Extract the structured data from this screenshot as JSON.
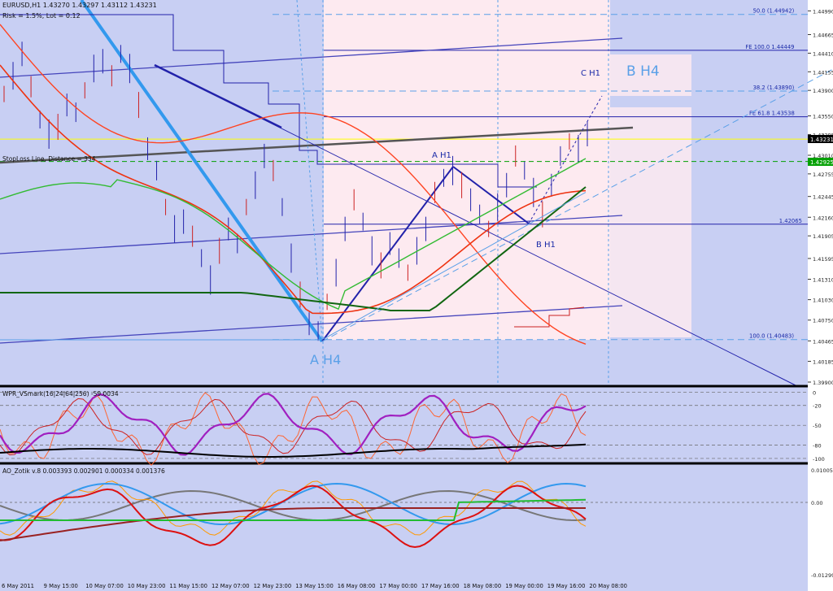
{
  "window": {
    "header": "EURUSD,H1  1.43270 1.43297 1.43112 1.43231",
    "risk_text": "Risk = 1.5%, Lot = 0.12",
    "stoploss_label": "StopLoss Line, Distance = 334"
  },
  "chart_data": [
    {
      "type": "line",
      "panel": "price",
      "symbol": "EURUSD",
      "timeframe": "H1",
      "ohlc": {
        "open": 1.4327,
        "high": 1.43297,
        "low": 1.43112,
        "close": 1.43231
      },
      "ylim": [
        1.399,
        1.4505
      ],
      "y_ticks": [
        "1.44990",
        "1.44665",
        "1.44410",
        "1.44155",
        "1.43900",
        "1.43550",
        "1.43295",
        "1.43010",
        "1.42755",
        "1.42445",
        "1.42160",
        "1.41905",
        "1.41595",
        "1.41310",
        "1.41030",
        "1.40750",
        "1.40465",
        "1.40185",
        "1.39900"
      ],
      "current_price": "1.43231",
      "stoploss_price": "1.42925",
      "series": [
        {
          "name": "price",
          "values": [
            1.4385,
            1.441,
            1.444,
            1.4395,
            1.435,
            1.433,
            1.434,
            1.437,
            1.436,
            1.439,
            1.442,
            1.443,
            1.441,
            1.444,
            1.442,
            1.437,
            1.431,
            1.428,
            1.423,
            1.42,
            1.421,
            1.419,
            1.416,
            1.413,
            1.417,
            1.42,
            1.418,
            1.423,
            1.426,
            1.43,
            1.428,
            1.423,
            1.416,
            1.411,
            1.407,
            1.406,
            1.41,
            1.414,
            1.42,
            1.424,
            1.421,
            1.417,
            1.415,
            1.418,
            1.416,
            1.414,
            1.417,
            1.42,
            1.425,
            1.427,
            1.428,
            1.426,
            1.424,
            1.422,
            1.42,
            1.423,
            1.426,
            1.43,
            1.428,
            1.425,
            1.422,
            1.426,
            1.43,
            1.432,
            1.431,
            1.433
          ]
        }
      ],
      "levels": [
        {
          "label": "50.0 (1.44942)",
          "value": 1.44942
        },
        {
          "label": "FE 100.0 1.44449",
          "value": 1.44449
        },
        {
          "label": "38.2 (1.43890)",
          "value": 1.4389
        },
        {
          "label": "FE 61.8 1.43538",
          "value": 1.43538
        },
        {
          "label": "1.42065",
          "value": 1.42065
        },
        {
          "label": "100.0 (1.40483)",
          "value": 1.40483
        }
      ],
      "annotations": [
        "A H4",
        "B H4",
        "A H1",
        "B H1",
        "C H1"
      ],
      "x_ticks": [
        "6 May 2011",
        "9 May 15:00",
        "10 May 07:00",
        "10 May 23:00",
        "11 May 15:00",
        "12 May 07:00",
        "12 May 23:00",
        "13 May 15:00",
        "16 May 08:00",
        "17 May 00:00",
        "17 May 16:00",
        "18 May 08:00",
        "19 May 00:00",
        "19 May 16:00",
        "20 May 08:00"
      ]
    },
    {
      "type": "line",
      "panel": "indicator",
      "title": "WPR_VSmark(16|24|64|256) -59.0034",
      "ylim": [
        -105,
        3
      ],
      "y_ticks": [
        "0",
        "-20",
        "-50",
        "-80",
        "-100"
      ]
    },
    {
      "type": "line",
      "panel": "indicator",
      "title": "AO_Zotik v.8 0.003393 0.002901 0.000334 0.001376",
      "y_ticks": [
        "0.01005",
        "0.00",
        "-0.01299"
      ]
    }
  ],
  "colors": {
    "background": "#c8cff3",
    "pink_zone": "#fdeaf0",
    "line_blue": "#2222aa",
    "thick_blue": "#3399ee",
    "fib_blue": "#5aa0e8",
    "text_blue": "#1a2aa8",
    "current_price": "#ffff00",
    "stoploss": "#00a000",
    "wpr_purple": "#a020c0",
    "ao_blue": "#3399ee",
    "ao_red": "#dd1111",
    "ao_darkred": "#992222",
    "ao_green": "#22bb33",
    "ao_gray": "#777777",
    "ao_orange": "#ff9900"
  }
}
